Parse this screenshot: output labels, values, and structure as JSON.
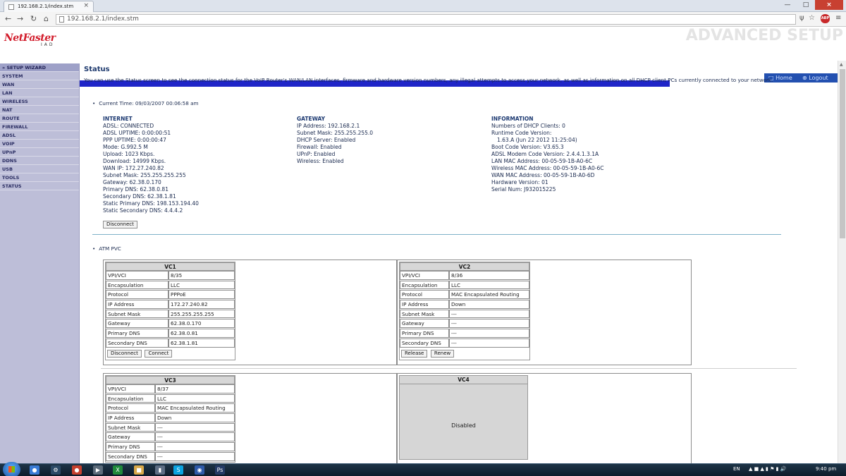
{
  "browser": {
    "tab_title": "192.168.2.1/index.stm",
    "url": "192.168.2.1/index.stm",
    "close_glyph": "×",
    "abp_label": "ABP"
  },
  "header": {
    "logo": "NetFaster",
    "logo_sub": "IAD",
    "title": "ADVANCED SETUP",
    "home_link": "Home",
    "logout_link": "Logout"
  },
  "sidebar": {
    "items": [
      "» SETUP WIZARD",
      "SYSTEM",
      "WAN",
      "LAN",
      "WIRELESS",
      "NAT",
      "ROUTE",
      "FIREWALL",
      "ADSL",
      "VOIP",
      "UPnP",
      "DDNS",
      "USB",
      "TOOLS",
      "STATUS"
    ]
  },
  "status": {
    "title": "Status",
    "description": "You can use the Status screen to see the connection status for the VoIP Router's WAN/LAN interfaces, firmware and hardware version numbers, any illegal attempts to access your network, as well as information on all DHCP client PCs currently connected to your network.",
    "current_time": "Current Time: 09/03/2007 00:06:58 am",
    "internet": {
      "heading": "INTERNET",
      "lines": [
        "ADSL:  CONNECTED",
        "ADSL UPTIME:  0:00:00:51",
        "PPP UPTIME:  0:00:00:47",
        "Mode:  G.992.5 M",
        "Upload:  1023 Kbps.",
        "Download:  14999 Kbps.",
        "WAN IP:  172.27.240.82",
        "Subnet Mask:  255.255.255.255",
        "Gateway:  62.38.0.170",
        "Primary DNS:  62.38.0.81",
        "Secondary DNS:  62.38.1.81",
        "Static Primary DNS:  198.153.194.40",
        "Static Secondary DNS:  4.4.4.2"
      ],
      "disconnect_label": "Disconnect"
    },
    "gateway": {
      "heading": "GATEWAY",
      "lines": [
        "IP Address:  192.168.2.1",
        "Subnet Mask:  255.255.255.0",
        "DHCP Server:  Enabled",
        "Firewall:  Enabled",
        "UPnP:  Enabled",
        "Wireless:  Enabled"
      ]
    },
    "information": {
      "heading": "INFORMATION",
      "lines": [
        "Numbers of DHCP Clients:  0",
        "Runtime Code Version:",
        "  1.63.A (Jun 22 2012 11:25:04)",
        "Boot Code Version:  V3.65.3",
        "ADSL Modem Code Version:  2.4.4.1.3.1A",
        "LAN MAC Address:  00-05-59-1B-A0-6C",
        "Wireless MAC Address:  00-05-59-1B-A0-6C",
        "WAN MAC Address:  00-05-59-1B-A0-6D",
        "Hardware Version:  01",
        "Serial Num:  J932015225"
      ]
    },
    "atm_label": "ATM PVC"
  },
  "vc": {
    "keys": [
      "VPI/VCI",
      "Encapsulation",
      "Protocol",
      "IP Address",
      "Subnet Mask",
      "Gateway",
      "Primary DNS",
      "Secondary DNS"
    ],
    "vc1": {
      "title": "VC1",
      "values": [
        "8/35",
        "LLC",
        "PPPoE",
        "172.27.240.82",
        "255.255.255.255",
        "62.38.0.170",
        "62.38.0.81",
        "62.38.1.81"
      ],
      "btn1": "Disconnect",
      "btn2": "Connect"
    },
    "vc2": {
      "title": "VC2",
      "values": [
        "8/36",
        "LLC",
        "MAC Encapsulated Routing",
        "Down",
        "---",
        "---",
        "---",
        "---"
      ],
      "btn1": "Release",
      "btn2": "Renew"
    },
    "vc3": {
      "title": "VC3",
      "values": [
        "8/37",
        "LLC",
        "MAC Encapsulated Routing",
        "Down",
        "---",
        "---",
        "---",
        "---"
      ]
    },
    "vc4": {
      "title": "VC4",
      "status": "Disabled"
    }
  },
  "taskbar": {
    "lang": "EN",
    "clock": "9:40 pm"
  }
}
